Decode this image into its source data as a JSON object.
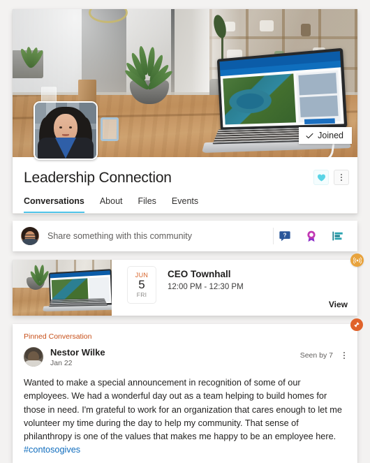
{
  "community": {
    "title": "Leadership Connection",
    "joined_label": "Joined",
    "joined_icon": "checkmark-icon",
    "heart_icon": "heart-filled-icon",
    "more_icon": "more-options-icon",
    "avatar_icon": "community-avatar",
    "banner_icon": "community-cover-photo",
    "accent_color": "#4fc3e8"
  },
  "tabs": [
    {
      "label": "Conversations",
      "active": true
    },
    {
      "label": "About",
      "active": false
    },
    {
      "label": "Files",
      "active": false
    },
    {
      "label": "Events",
      "active": false
    }
  ],
  "share": {
    "placeholder": "Share something with this community",
    "avatar_icon": "user-avatar",
    "icons": [
      {
        "name": "question-icon",
        "label": "Ask a question",
        "color": "#2b579a"
      },
      {
        "name": "praise-icon",
        "label": "Praise",
        "color": "#c239b3"
      },
      {
        "name": "poll-icon",
        "label": "Poll",
        "color": "#0f7a8a"
      }
    ]
  },
  "event": {
    "month": "JUN",
    "day": "5",
    "weekday": "FRI",
    "title": "CEO Townhall",
    "time": "12:00 PM - 12:30 PM",
    "view_label": "View",
    "live_badge_icon": "live-broadcast-icon",
    "live_badge_color": "#e8a33d",
    "thumbnail_icon": "event-thumbnail"
  },
  "post": {
    "pinned_label": "Pinned Conversation",
    "pinned_color": "#c74f18",
    "pin_badge_icon": "pin-icon",
    "author": "Nestor Wilke",
    "date": "Jan 22",
    "seen_by": "Seen by 7",
    "more_icon": "more-options-icon",
    "avatar_icon": "author-avatar",
    "body_text": "Wanted to make a special announcement in recognition of some of our employees. We had a wonderful day out as a team helping to build homes for those in need. I'm grateful to work for an organization that cares enough to let me volunteer my time during the day to help my community. That sense of philanthropy is one of the values that makes me happy to be an employee here. ",
    "hashtag": "#contosogives"
  }
}
